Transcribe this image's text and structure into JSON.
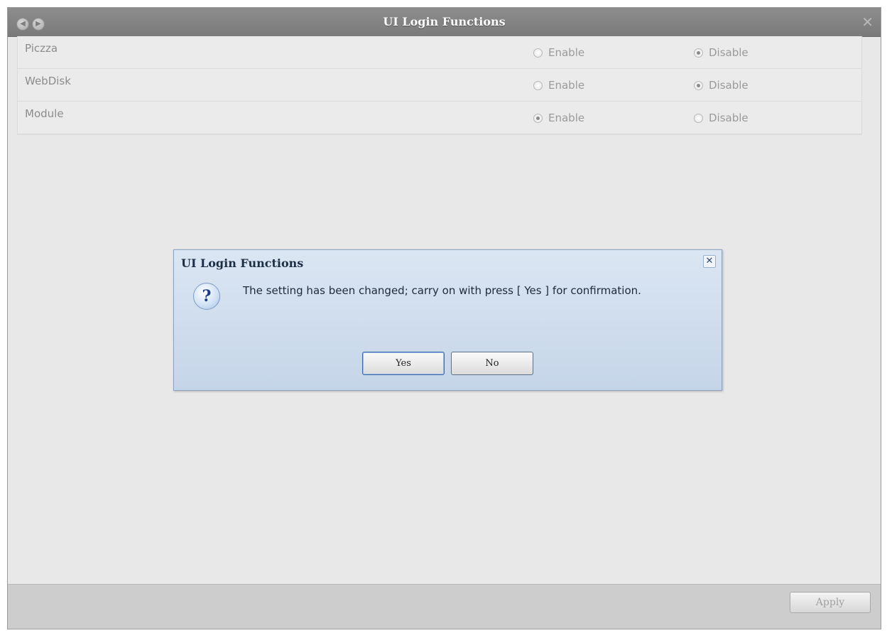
{
  "window": {
    "title": "UI Login Functions",
    "back_icon": "back-arrow-icon",
    "forward_icon": "forward-arrow-icon",
    "close_glyph": "✕"
  },
  "settings": {
    "rows": [
      {
        "label": "Piczza",
        "enable_label": "Enable",
        "disable_label": "Disable",
        "selected": "disable"
      },
      {
        "label": "WebDisk",
        "enable_label": "Enable",
        "disable_label": "Disable",
        "selected": "disable"
      },
      {
        "label": "Module",
        "enable_label": "Enable",
        "disable_label": "Disable",
        "selected": "enable"
      }
    ]
  },
  "footer": {
    "apply_label": "Apply"
  },
  "dialog": {
    "title": "UI Login Functions",
    "close_glyph": "✕",
    "icon": "question-icon",
    "icon_glyph": "?",
    "message": "The setting has been changed; carry on with press [ Yes ] for confirmation.",
    "yes_label": "Yes",
    "no_label": "No"
  },
  "colors": {
    "titlebar": "#7f7f7f",
    "dialog_bg": "#cfdcec",
    "accent": "#3c68a6"
  }
}
